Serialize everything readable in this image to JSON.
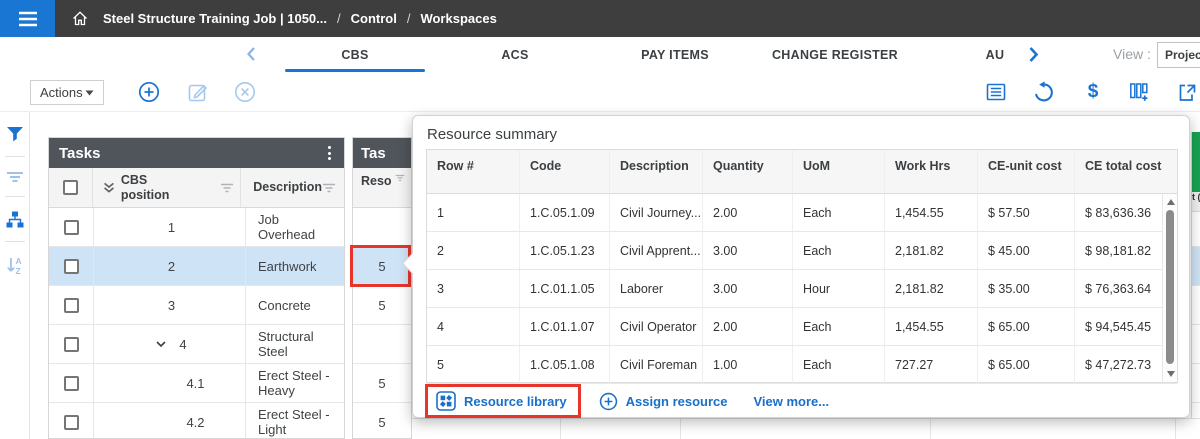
{
  "topbar": {
    "job": "Steel Structure Training Job | 1050...",
    "sep1": "/",
    "section": "Control",
    "sep2": "/",
    "page": "Workspaces"
  },
  "tabbar": {
    "tabs": [
      {
        "label": "CBS"
      },
      {
        "label": "ACS"
      },
      {
        "label": "PAY ITEMS"
      },
      {
        "label": "CHANGE REGISTER"
      },
      {
        "label": "AU"
      }
    ],
    "view_label": "View :",
    "view_value": "Project c"
  },
  "toolbar": {
    "actions": "Actions"
  },
  "icons": {
    "left_rail": [
      "filter-icon",
      "filter-lines-icon",
      "hierarchy-icon",
      "sort-az-icon"
    ],
    "toolbar_left": [
      "add-circle-icon",
      "edit-icon",
      "cancel-circle-icon"
    ],
    "toolbar_right": [
      "view-summary-icon",
      "undo-icon",
      "currency-icon",
      "add-column-icon",
      "export-icon"
    ]
  },
  "tasks": {
    "title": "Tasks",
    "col_cbs": "CBS position",
    "col_desc": "Description",
    "rows": [
      {
        "pos": "1",
        "desc": "Job Overhead"
      },
      {
        "pos": "2",
        "desc": "Earthwork"
      },
      {
        "pos": "3",
        "desc": "Concrete"
      },
      {
        "pos": "4",
        "desc": "Structural Steel"
      },
      {
        "pos": "4.1",
        "desc": "Erect Steel - Heavy"
      },
      {
        "pos": "4.2",
        "desc": "Erect Steel - Light"
      }
    ]
  },
  "resources_col": {
    "title": "Tas",
    "col": "Reso",
    "cells": [
      "",
      "5",
      "5",
      "",
      "5",
      "5"
    ]
  },
  "popup": {
    "title": "Resource summary",
    "columns": [
      "Row #",
      "Code",
      "Description",
      "Quantity",
      "UoM",
      "Work Hrs",
      "CE-unit cost",
      "CE total cost"
    ],
    "rows": [
      [
        "1",
        "1.C.05.1.09",
        "Civil Journey...",
        "2.00",
        "Each",
        "1,454.55",
        "$ 57.50",
        "$ 83,636.36"
      ],
      [
        "2",
        "1.C.05.1.23",
        "Civil Apprent...",
        "3.00",
        "Each",
        "2,181.82",
        "$ 45.00",
        "$ 98,181.82"
      ],
      [
        "3",
        "1.C.01.1.05",
        "Laborer",
        "3.00",
        "Hour",
        "2,181.82",
        "$ 35.00",
        "$ 76,363.64"
      ],
      [
        "4",
        "1.C.01.1.07",
        "Civil Operator",
        "2.00",
        "Each",
        "1,454.55",
        "$ 65.00",
        "$ 94,545.45"
      ],
      [
        "5",
        "1.C.05.1.08",
        "Civil Foreman",
        "1.00",
        "Each",
        "727.27",
        "$ 65.00",
        "$ 47,272.73"
      ]
    ],
    "footer": {
      "library": "Resource library",
      "assign": "Assign resource",
      "more": "View more..."
    }
  },
  "sliver_text": "t (",
  "colors": {
    "accent_blue": "#1a73d2",
    "disabled_blue": "#a6c8ee",
    "link_blue": "#1a6fc9",
    "selected_row": "#cfe3f6",
    "annotation_red": "#e8352b",
    "panel_header_dark": "#4f555b",
    "topbar_dark": "#3e3e3e",
    "menu_blue": "#1976d2",
    "green_header": "#17a353"
  }
}
